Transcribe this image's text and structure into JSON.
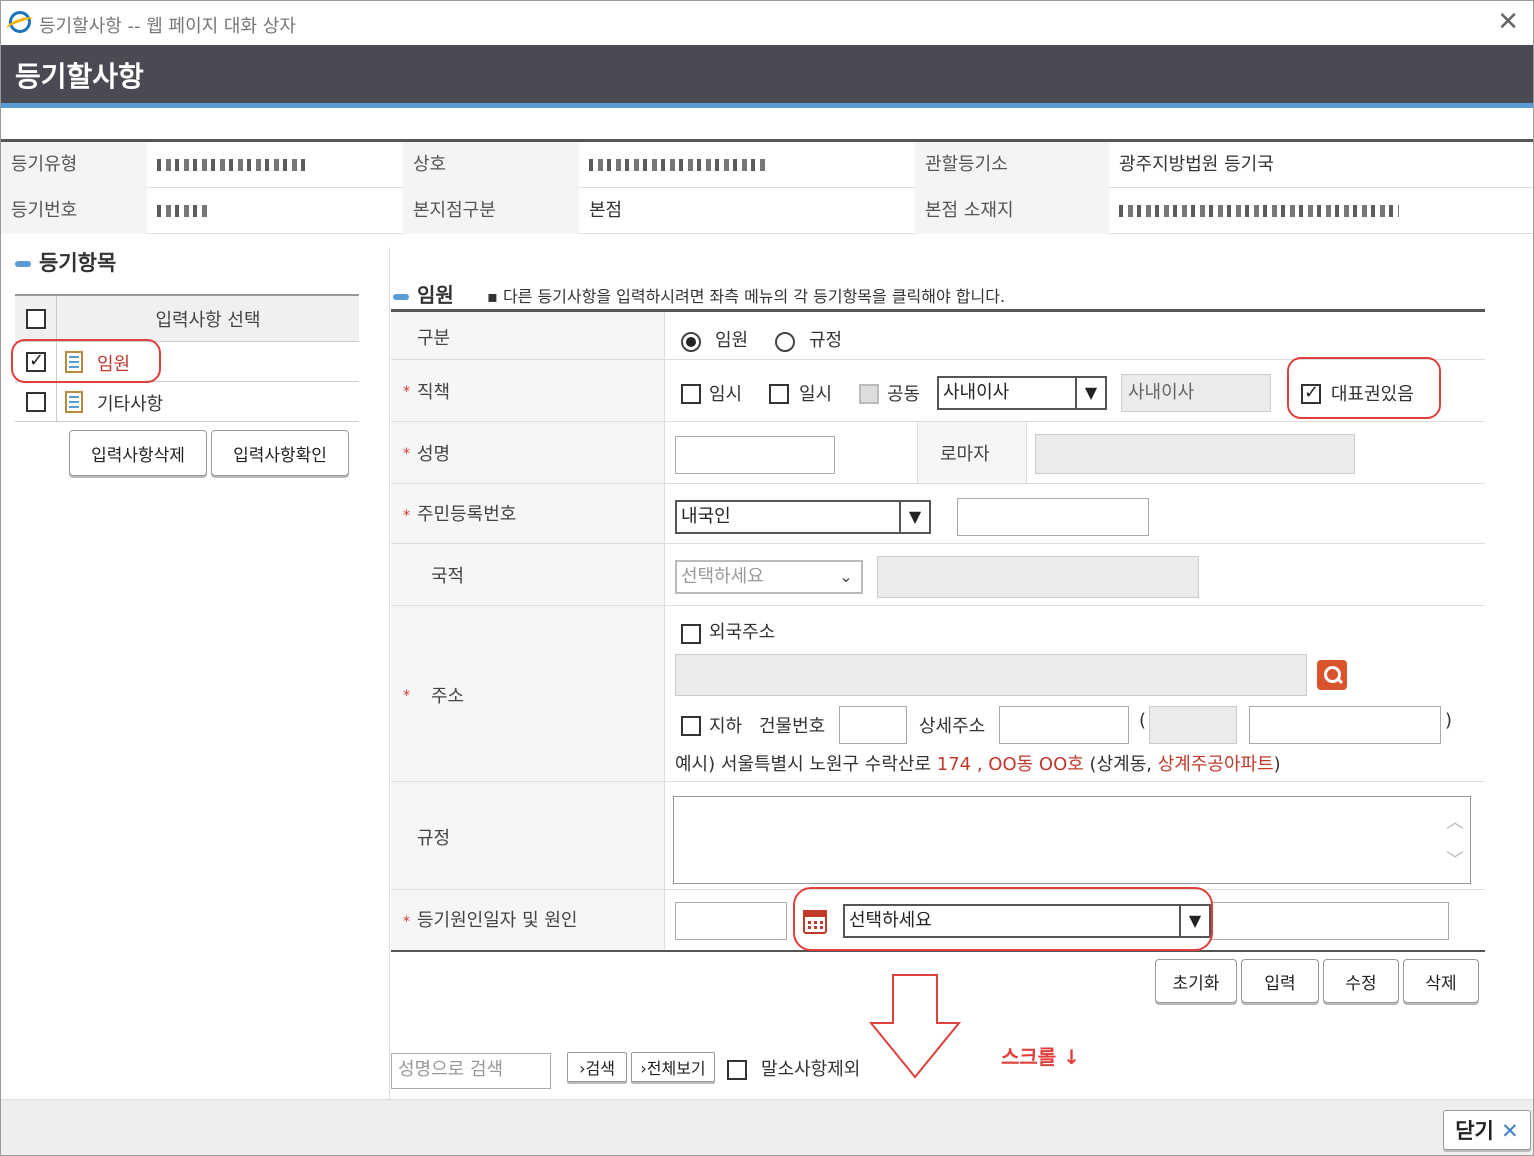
{
  "window": {
    "title": "등기할사항 -- 웹 페이지 대화 상자",
    "close": "✕"
  },
  "header": {
    "title": "등기할사항"
  },
  "info": {
    "row1": {
      "label1": "등기유형",
      "label2": "상호",
      "label3": "관할등기소",
      "value3": "광주지방법원 등기국"
    },
    "row2": {
      "label1": "등기번호",
      "label2": "본지점구분",
      "value2": "본점",
      "label3": "본점 소재지"
    }
  },
  "left": {
    "title": "등기항목",
    "header_label": "입력사항 선택",
    "items": [
      {
        "label": "임원",
        "checked": true,
        "color": "#c0392b"
      },
      {
        "label": "기타사항",
        "checked": false,
        "color": "#333333"
      }
    ],
    "btn_delete": "입력사항삭제",
    "btn_confirm": "입력사항확인"
  },
  "section": {
    "title": "임원",
    "note": "다른 등기사항을 입력하시려면 좌측 메뉴의 각 등기항목을 클릭해야 합니다."
  },
  "form": {
    "gubun": {
      "label": "구분",
      "opt1": "임원",
      "opt2": "규정"
    },
    "position": {
      "label": "직책",
      "temp": "임시",
      "ilsi": "일시",
      "joint": "공동",
      "select_value": "사내이사",
      "display_value": "사내이사",
      "rep": "대표권있음"
    },
    "name": {
      "label": "성명",
      "roman_label": "로마자"
    },
    "rrn": {
      "label": "주민등록번호",
      "select_value": "내국인"
    },
    "nationality": {
      "label": "국적",
      "select_value": "선택하세요"
    },
    "address": {
      "label": "주소",
      "foreign": "외국주소",
      "basement": "지하",
      "bldg_no": "건물번호",
      "detail": "상세주소",
      "paren_open": "(",
      "paren_close": ")",
      "example_prefix": "예시) 서울특별시 노원구 수락산로",
      "example_num": "174 , OO동 OO호",
      "example_mid": "(상계동,",
      "example_apt": "상계주공아파트",
      "example_end": ")"
    },
    "rule": {
      "label": "규정"
    },
    "cause": {
      "label": "등기원인일자 및 원인",
      "select_value": "선택하세요"
    }
  },
  "actions": {
    "reset": "초기화",
    "input": "입력",
    "modify": "수정",
    "delete": "삭제"
  },
  "search": {
    "placeholder": "성명으로 검색",
    "search_btn": "검색",
    "view_all_btn": "전체보기",
    "exclude_label": "말소사항제외"
  },
  "annotation": {
    "scroll": "스크롤 ↓"
  },
  "footer": {
    "close_btn": "닫기"
  }
}
